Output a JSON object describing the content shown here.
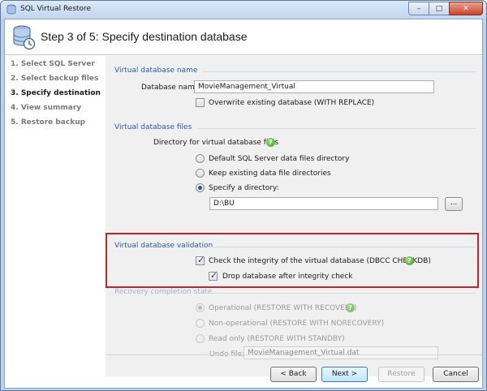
{
  "window": {
    "title": "SQL Virtual Restore",
    "controls": {
      "minimize": "–",
      "maximize": "□",
      "close": "✕"
    }
  },
  "header": {
    "title": "Step 3 of 5: Specify destination database"
  },
  "nav": {
    "items": [
      {
        "label": "1. Select SQL Server",
        "state": "done"
      },
      {
        "label": "2. Select backup files",
        "state": "done"
      },
      {
        "label": "3. Specify destination",
        "state": "current"
      },
      {
        "label": "4. View summary",
        "state": "pending"
      },
      {
        "label": "5. Restore backup",
        "state": "pending"
      }
    ]
  },
  "name_section": {
    "title": "Virtual database name",
    "db_name_label": "Database name:",
    "db_name_value": "MovieManagement_Virtual",
    "overwrite_label": "Overwrite existing database (WITH REPLACE)",
    "overwrite_checked": false
  },
  "files_section": {
    "title": "Virtual database files",
    "dir_label": "Directory for virtual database files",
    "options": [
      {
        "label": "Default SQL Server data files directory",
        "selected": false
      },
      {
        "label": "Keep existing data file directories",
        "selected": false
      },
      {
        "label": "Specify a directory:",
        "selected": true
      }
    ],
    "directory_value": "D:\\BU",
    "browse_label": "..."
  },
  "validation_section": {
    "title": "Virtual database validation",
    "check_integrity_label": "Check the integrity of the virtual database (DBCC CHECKDB)",
    "check_integrity_checked": true,
    "drop_label": "Drop database after integrity check",
    "drop_checked": true
  },
  "recovery_section": {
    "title": "Recovery completion state",
    "options": [
      {
        "label": "Operational (RESTORE WITH RECOVERY)",
        "selected": true
      },
      {
        "label": "Non-operational (RESTORE WITH NORECOVERY)",
        "selected": false
      },
      {
        "label": "Read only (RESTORE WITH STANDBY)",
        "selected": false
      }
    ],
    "undo_label": "Undo file:",
    "undo_value": "MovieManagement_Virtual.dat"
  },
  "footer": {
    "back": "< Back",
    "next": "Next >",
    "restore": "Restore",
    "cancel": "Cancel"
  },
  "colors": {
    "section_title": "#2c5aa8",
    "highlight": "#c0262c",
    "help_green": "#3e9a1e"
  }
}
